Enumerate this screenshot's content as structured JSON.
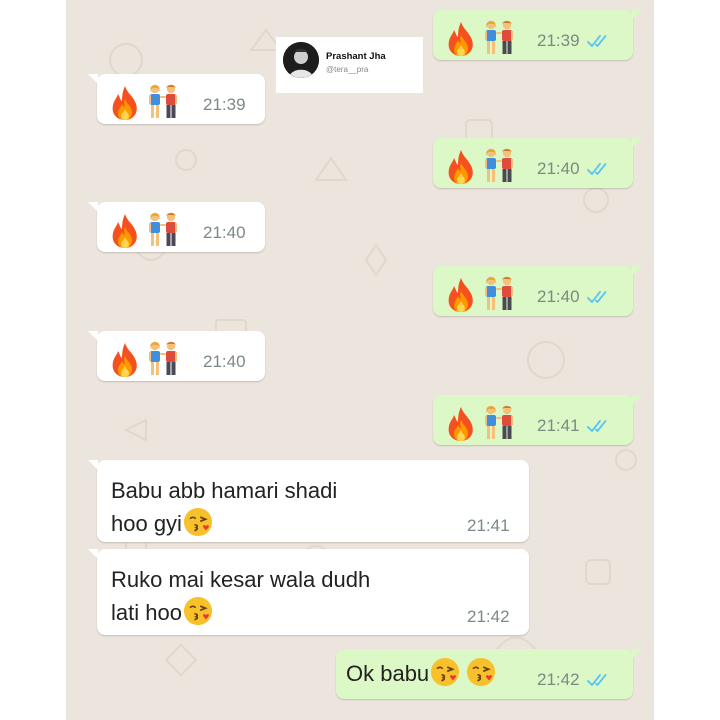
{
  "watermark": {
    "name": "Prashant Jha",
    "handle": "@tera__pra"
  },
  "colors": {
    "chat_background": "#ece5dd",
    "outgoing_bubble": "#dcf8c6",
    "incoming_bubble": "#ffffff",
    "read_ticks": "#4fc3f7",
    "timestamp": "#7b8a86"
  },
  "messages": [
    {
      "direction": "outgoing",
      "emoji": [
        "fire",
        "couple"
      ],
      "time": "21:39",
      "status": "read"
    },
    {
      "direction": "incoming",
      "emoji": [
        "fire",
        "couple"
      ],
      "time": "21:39"
    },
    {
      "direction": "outgoing",
      "emoji": [
        "fire",
        "couple"
      ],
      "time": "21:40",
      "status": "read"
    },
    {
      "direction": "incoming",
      "emoji": [
        "fire",
        "couple"
      ],
      "time": "21:40"
    },
    {
      "direction": "outgoing",
      "emoji": [
        "fire",
        "couple"
      ],
      "time": "21:40",
      "status": "read"
    },
    {
      "direction": "incoming",
      "emoji": [
        "fire",
        "couple"
      ],
      "time": "21:40"
    },
    {
      "direction": "outgoing",
      "emoji": [
        "fire",
        "couple"
      ],
      "time": "21:41",
      "status": "read"
    },
    {
      "direction": "incoming",
      "lines": [
        "Babu abb hamari shadi",
        "hoo gyi"
      ],
      "trailing_emoji": [
        "kissing-face"
      ],
      "time": "21:41"
    },
    {
      "direction": "incoming",
      "lines": [
        "Ruko mai kesar wala dudh",
        "lati hoo"
      ],
      "trailing_emoji": [
        "kissing-face"
      ],
      "time": "21:42"
    },
    {
      "direction": "outgoing",
      "text": "Ok babu",
      "trailing_emoji": [
        "kissing-face",
        "kissing-face"
      ],
      "time": "21:42",
      "status": "read"
    }
  ]
}
